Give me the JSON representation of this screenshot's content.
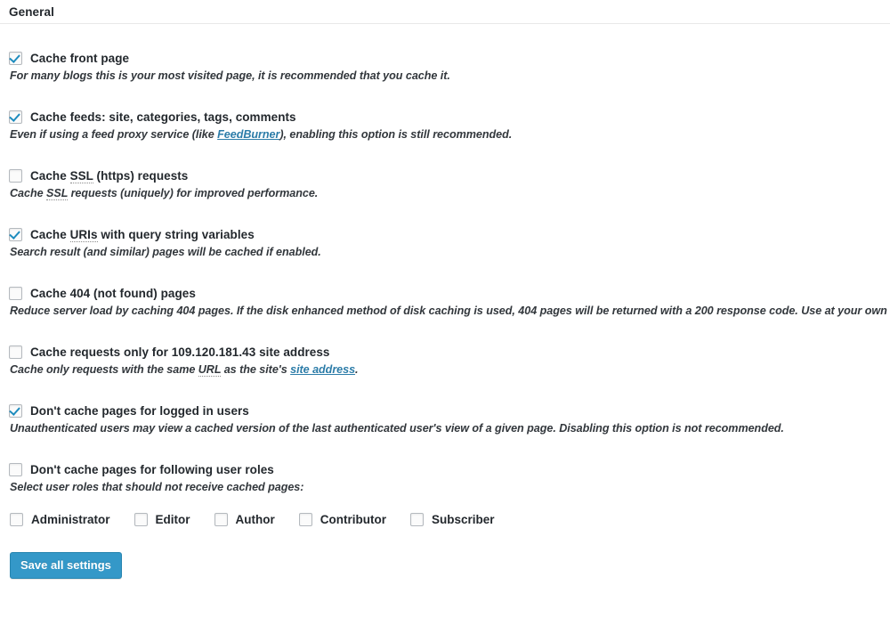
{
  "section": {
    "title": "General"
  },
  "options": [
    {
      "id": "cache-front-page",
      "label": "Cache front page",
      "checked": true,
      "desc_parts": [
        {
          "type": "text",
          "text": "For many blogs this is your most visited page, it is recommended that you cache it."
        }
      ]
    },
    {
      "id": "cache-feeds",
      "label": "Cache feeds: site, categories, tags, comments",
      "checked": true,
      "desc_parts": [
        {
          "type": "text",
          "text": "Even if using a feed proxy service (like "
        },
        {
          "type": "link",
          "text": "FeedBurner"
        },
        {
          "type": "text",
          "text": "), enabling this option is still recommended."
        }
      ]
    },
    {
      "id": "cache-ssl",
      "label_parts": [
        {
          "type": "text",
          "text": "Cache "
        },
        {
          "type": "abbr",
          "text": "SSL"
        },
        {
          "type": "text",
          "text": " (https) requests"
        }
      ],
      "label": "Cache SSL (https) requests",
      "checked": false,
      "desc_parts": [
        {
          "type": "text",
          "text": "Cache "
        },
        {
          "type": "abbr",
          "text": "SSL"
        },
        {
          "type": "text",
          "text": " requests (uniquely) for improved performance."
        }
      ]
    },
    {
      "id": "cache-query-string",
      "label_parts": [
        {
          "type": "text",
          "text": "Cache "
        },
        {
          "type": "abbr",
          "text": "URIs"
        },
        {
          "type": "text",
          "text": " with query string variables"
        }
      ],
      "label": "Cache URIs with query string variables",
      "checked": true,
      "desc_parts": [
        {
          "type": "text",
          "text": "Search result (and similar) pages will be cached if enabled."
        }
      ]
    },
    {
      "id": "cache-404",
      "label": "Cache 404 (not found) pages",
      "checked": false,
      "desc_parts": [
        {
          "type": "text",
          "text": "Reduce server load by caching 404 pages. If the disk enhanced method of disk caching is used, 404 pages will be returned with a 200 response code. Use at your own risk."
        }
      ]
    },
    {
      "id": "cache-site-address-only",
      "label": "Cache requests only for 109.120.181.43 site address",
      "checked": false,
      "desc_parts": [
        {
          "type": "text",
          "text": "Cache only requests with the same "
        },
        {
          "type": "abbr",
          "text": "URL"
        },
        {
          "type": "text",
          "text": " as the site's "
        },
        {
          "type": "link",
          "text": "site address"
        },
        {
          "type": "text",
          "text": "."
        }
      ]
    },
    {
      "id": "dont-cache-logged-in",
      "label": "Don't cache pages for logged in users",
      "checked": true,
      "desc_parts": [
        {
          "type": "text",
          "text": "Unauthenticated users may view a cached version of the last authenticated user's view of a given page. Disabling this option is not recommended."
        }
      ]
    },
    {
      "id": "dont-cache-roles",
      "label": "Don't cache pages for following user roles",
      "checked": false,
      "desc_parts": [
        {
          "type": "text",
          "text": "Select user roles that should not receive cached pages:"
        }
      ]
    }
  ],
  "user_roles": [
    {
      "id": "administrator",
      "label": "Administrator",
      "checked": false
    },
    {
      "id": "editor",
      "label": "Editor",
      "checked": false
    },
    {
      "id": "author",
      "label": "Author",
      "checked": false
    },
    {
      "id": "contributor",
      "label": "Contributor",
      "checked": false
    },
    {
      "id": "subscriber",
      "label": "Subscriber",
      "checked": false
    }
  ],
  "actions": {
    "save_label": "Save all settings"
  },
  "site_ip": "109.120.181.43",
  "colors": {
    "accent": "#3498c8",
    "accent_border": "#2785b0",
    "link": "#2c7ca8",
    "checkmark": "#1e8cbe",
    "text": "#23282d",
    "divider": "#e8e8e8",
    "checkbox_border": "#b4b9be"
  }
}
